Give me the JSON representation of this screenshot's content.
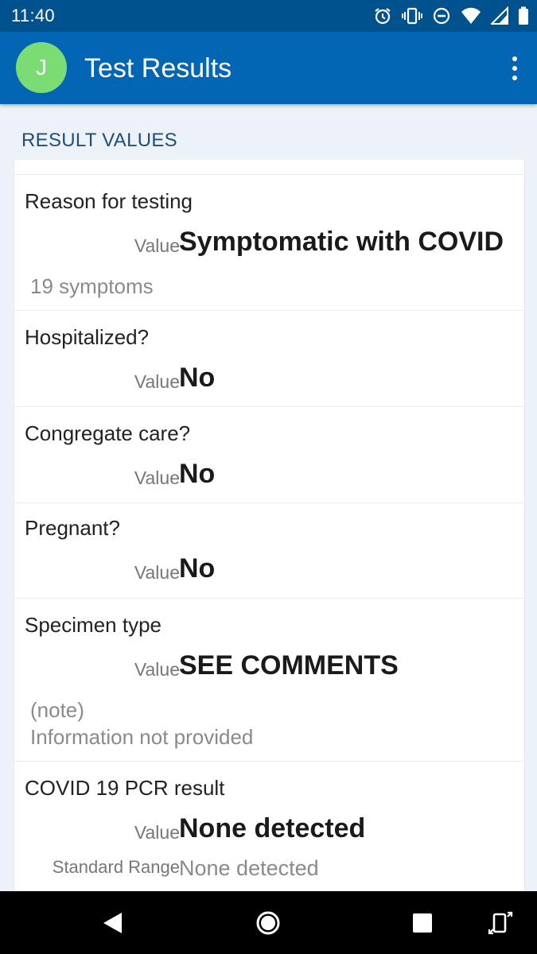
{
  "status_bar": {
    "time": "11:40",
    "icons": [
      "alarm-icon",
      "vibrate-icon",
      "do-not-disturb-icon",
      "wifi-icon",
      "cell-signal-icon",
      "battery-icon"
    ]
  },
  "app_bar": {
    "avatar_initial": "J",
    "title": "Test Results",
    "menu_icon": "more-vert-icon"
  },
  "section": {
    "title": "RESULT VALUES"
  },
  "results": [
    {
      "label": "Reason for testing",
      "value_key": "Value",
      "value": "Symptomatic with COVID",
      "note": "19 symptoms"
    },
    {
      "label": "Hospitalized?",
      "value_key": "Value",
      "value": "No"
    },
    {
      "label": "Congregate care?",
      "value_key": "Value",
      "value": "No"
    },
    {
      "label": "Pregnant?",
      "value_key": "Value",
      "value": "No"
    },
    {
      "label": "Specimen type",
      "value_key": "Value",
      "value": "SEE COMMENTS",
      "note_title": "(note)",
      "note_text": "Information not provided"
    },
    {
      "label": "COVID 19 PCR result",
      "value_key": "Value",
      "value": "None detected",
      "range_key": "Standard Range",
      "range_value": "None detected"
    }
  ],
  "nav_bar": {
    "icons": [
      "back-icon",
      "home-icon",
      "recents-icon",
      "rotate-icon"
    ]
  },
  "colors": {
    "status_bar": "#00528f",
    "app_bar": "#0366b4",
    "avatar": "#7bdc73",
    "section_bg": "#edf1f8",
    "section_title": "#1f4e79"
  }
}
